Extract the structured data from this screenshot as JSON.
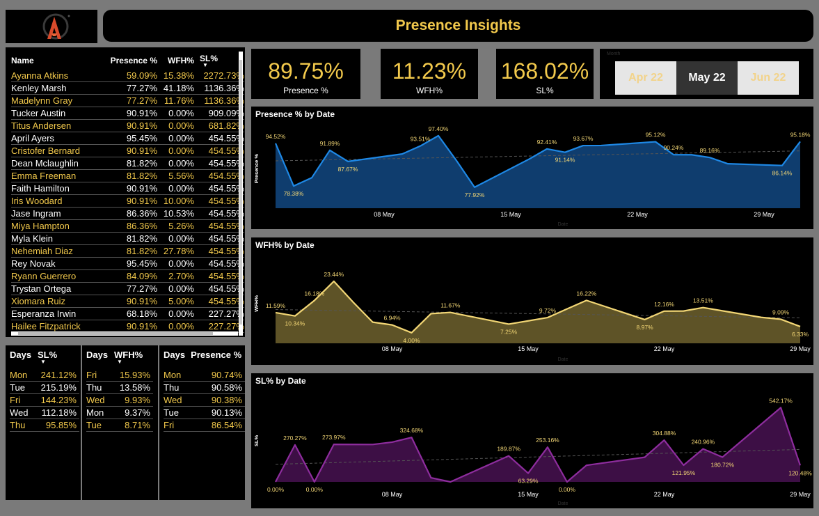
{
  "header": {
    "title": "Presence Insights"
  },
  "people": {
    "columns": [
      "Name",
      "Presence %",
      "WFH%",
      "SL%"
    ],
    "rows": [
      {
        "name": "Ayanna Atkins",
        "presence": "59.09%",
        "wfh": "15.38%",
        "sl": "2272.73%"
      },
      {
        "name": "Kenley Marsh",
        "presence": "77.27%",
        "wfh": "41.18%",
        "sl": "1136.36%"
      },
      {
        "name": "Madelynn Gray",
        "presence": "77.27%",
        "wfh": "11.76%",
        "sl": "1136.36%"
      },
      {
        "name": "Tucker Austin",
        "presence": "90.91%",
        "wfh": "0.00%",
        "sl": "909.09%"
      },
      {
        "name": "Titus Andersen",
        "presence": "90.91%",
        "wfh": "0.00%",
        "sl": "681.82%"
      },
      {
        "name": "April Ayers",
        "presence": "95.45%",
        "wfh": "0.00%",
        "sl": "454.55%"
      },
      {
        "name": "Cristofer Bernard",
        "presence": "90.91%",
        "wfh": "0.00%",
        "sl": "454.55%"
      },
      {
        "name": "Dean Mclaughlin",
        "presence": "81.82%",
        "wfh": "0.00%",
        "sl": "454.55%"
      },
      {
        "name": "Emma Freeman",
        "presence": "81.82%",
        "wfh": "5.56%",
        "sl": "454.55%"
      },
      {
        "name": "Faith Hamilton",
        "presence": "90.91%",
        "wfh": "0.00%",
        "sl": "454.55%"
      },
      {
        "name": "Iris Woodard",
        "presence": "90.91%",
        "wfh": "10.00%",
        "sl": "454.55%"
      },
      {
        "name": "Jase Ingram",
        "presence": "86.36%",
        "wfh": "10.53%",
        "sl": "454.55%"
      },
      {
        "name": "Miya Hampton",
        "presence": "86.36%",
        "wfh": "5.26%",
        "sl": "454.55%"
      },
      {
        "name": "Myla Klein",
        "presence": "81.82%",
        "wfh": "0.00%",
        "sl": "454.55%"
      },
      {
        "name": "Nehemiah Diaz",
        "presence": "81.82%",
        "wfh": "27.78%",
        "sl": "454.55%"
      },
      {
        "name": "Rey Novak",
        "presence": "95.45%",
        "wfh": "0.00%",
        "sl": "454.55%"
      },
      {
        "name": "Ryann Guerrero",
        "presence": "84.09%",
        "wfh": "2.70%",
        "sl": "454.55%"
      },
      {
        "name": "Trystan Ortega",
        "presence": "77.27%",
        "wfh": "0.00%",
        "sl": "454.55%"
      },
      {
        "name": "Xiomara Ruiz",
        "presence": "90.91%",
        "wfh": "5.00%",
        "sl": "454.55%"
      },
      {
        "name": "Esperanza Irwin",
        "presence": "68.18%",
        "wfh": "0.00%",
        "sl": "227.27%"
      },
      {
        "name": "Hailee Fitzpatrick",
        "presence": "90.91%",
        "wfh": "0.00%",
        "sl": "227.27%"
      }
    ]
  },
  "days_sl": {
    "columns": [
      "Days",
      "SL%"
    ],
    "rows": [
      {
        "day": "Mon",
        "val": "241.12%"
      },
      {
        "day": "Tue",
        "val": "215.19%"
      },
      {
        "day": "Fri",
        "val": "144.23%"
      },
      {
        "day": "Wed",
        "val": "112.18%"
      },
      {
        "day": "Thu",
        "val": "95.85%"
      }
    ]
  },
  "days_wfh": {
    "columns": [
      "Days",
      "WFH%"
    ],
    "rows": [
      {
        "day": "Fri",
        "val": "15.93%"
      },
      {
        "day": "Thu",
        "val": "13.58%"
      },
      {
        "day": "Wed",
        "val": "9.93%"
      },
      {
        "day": "Mon",
        "val": "9.37%"
      },
      {
        "day": "Tue",
        "val": "8.71%"
      }
    ]
  },
  "days_presence": {
    "columns": [
      "Days",
      "Presence %"
    ],
    "rows": [
      {
        "day": "Mon",
        "val": "90.74%"
      },
      {
        "day": "Thu",
        "val": "90.58%"
      },
      {
        "day": "Wed",
        "val": "90.38%"
      },
      {
        "day": "Tue",
        "val": "90.13%"
      },
      {
        "day": "Fri",
        "val": "86.54%"
      }
    ]
  },
  "kpis": {
    "presence": {
      "value": "89.75%",
      "label": "Presence %"
    },
    "wfh": {
      "value": "11.23%",
      "label": "WFH%"
    },
    "sl": {
      "value": "168.02%",
      "label": "SL%"
    }
  },
  "month_slicer": {
    "label": "Month",
    "options": [
      "Apr 22",
      "May 22",
      "Jun 22"
    ],
    "selected": "May 22"
  },
  "colors": {
    "accent": "#f2c94c",
    "presence": "#1e88e5",
    "wfh": "#f2d675",
    "sl": "#8e2d9e"
  },
  "chart_data": [
    {
      "type": "area",
      "title": "Presence % by Date",
      "xlabel": "Date",
      "ylabel": "Presence %",
      "x_ticks": [
        {
          "day": 8,
          "label": "08 May"
        },
        {
          "day": 15,
          "label": "15 May"
        },
        {
          "day": 22,
          "label": "22 May"
        },
        {
          "day": 29,
          "label": "29 May"
        }
      ],
      "ylim": [
        70,
        100
      ],
      "trendline": true,
      "points": [
        {
          "day": 2,
          "value": 94.52,
          "label": "94.52%"
        },
        {
          "day": 3,
          "value": 78.38,
          "label": "78.38%"
        },
        {
          "day": 4,
          "value": 81.5
        },
        {
          "day": 5,
          "value": 91.89,
          "label": "91.89%"
        },
        {
          "day": 6,
          "value": 87.67,
          "label": "87.67%"
        },
        {
          "day": 9,
          "value": 90.5
        },
        {
          "day": 10,
          "value": 93.51,
          "label": "93.51%"
        },
        {
          "day": 11,
          "value": 97.4,
          "label": "97.40%"
        },
        {
          "day": 12,
          "value": 88.0
        },
        {
          "day": 13,
          "value": 77.92,
          "label": "77.92%"
        },
        {
          "day": 16,
          "value": 88.5
        },
        {
          "day": 17,
          "value": 92.41,
          "label": "92.41%"
        },
        {
          "day": 18,
          "value": 91.14,
          "label": "91.14%"
        },
        {
          "day": 19,
          "value": 93.67,
          "label": "93.67%"
        },
        {
          "day": 20,
          "value": 93.7
        },
        {
          "day": 23,
          "value": 95.12,
          "label": "95.12%"
        },
        {
          "day": 24,
          "value": 90.24,
          "label": "90.24%"
        },
        {
          "day": 25,
          "value": 90.2
        },
        {
          "day": 26,
          "value": 89.16,
          "label": "89.16%"
        },
        {
          "day": 27,
          "value": 86.8
        },
        {
          "day": 30,
          "value": 86.14,
          "label": "86.14%"
        },
        {
          "day": 31,
          "value": 95.18,
          "label": "95.18%"
        }
      ]
    },
    {
      "type": "area",
      "title": "WFH% by Date",
      "xlabel": "Date",
      "ylabel": "WFH%",
      "x_ticks": [
        {
          "day": 8,
          "label": "08 May"
        },
        {
          "day": 15,
          "label": "15 May"
        },
        {
          "day": 22,
          "label": "22 May"
        },
        {
          "day": 29,
          "label": "29 May"
        }
      ],
      "ylim": [
        0,
        30
      ],
      "trendline": true,
      "points": [
        {
          "day": 2,
          "value": 11.59,
          "label": "11.59%"
        },
        {
          "day": 3,
          "value": 10.34,
          "label": "10.34%"
        },
        {
          "day": 4,
          "value": 16.18,
          "label": "16.18%"
        },
        {
          "day": 5,
          "value": 23.44,
          "label": "23.44%"
        },
        {
          "day": 6,
          "value": 15.5
        },
        {
          "day": 7,
          "value": 8.0
        },
        {
          "day": 8,
          "value": 6.94,
          "label": "6.94%"
        },
        {
          "day": 9,
          "value": 4.0,
          "label": "4.00%"
        },
        {
          "day": 10,
          "value": 11.2
        },
        {
          "day": 11,
          "value": 11.67,
          "label": "11.67%"
        },
        {
          "day": 14,
          "value": 7.25,
          "label": "7.25%"
        },
        {
          "day": 16,
          "value": 9.72,
          "label": "9.72%"
        },
        {
          "day": 17,
          "value": 13.0
        },
        {
          "day": 18,
          "value": 16.22,
          "label": "16.22%"
        },
        {
          "day": 21,
          "value": 8.97,
          "label": "8.97%"
        },
        {
          "day": 22,
          "value": 12.16,
          "label": "12.16%"
        },
        {
          "day": 23,
          "value": 12.2
        },
        {
          "day": 24,
          "value": 13.51,
          "label": "13.51%"
        },
        {
          "day": 27,
          "value": 9.8
        },
        {
          "day": 28,
          "value": 9.09,
          "label": "9.09%"
        },
        {
          "day": 29,
          "value": 6.33,
          "label": "6.33%"
        }
      ]
    },
    {
      "type": "area",
      "title": "SL% by Date",
      "xlabel": "Date",
      "ylabel": "SL%",
      "x_ticks": [
        {
          "day": 8,
          "label": "08 May"
        },
        {
          "day": 15,
          "label": "15 May"
        },
        {
          "day": 22,
          "label": "22 May"
        },
        {
          "day": 29,
          "label": "29 May"
        }
      ],
      "ylim": [
        0,
        600
      ],
      "trendline": true,
      "points": [
        {
          "day": 2,
          "value": 0.0,
          "label": "0.00%"
        },
        {
          "day": 3,
          "value": 270.27,
          "label": "270.27%"
        },
        {
          "day": 4,
          "value": 0.0,
          "label": "0.00%"
        },
        {
          "day": 5,
          "value": 273.97,
          "label": "273.97%"
        },
        {
          "day": 7,
          "value": 273.0
        },
        {
          "day": 8,
          "value": 290.0
        },
        {
          "day": 9,
          "value": 324.68,
          "label": "324.68%"
        },
        {
          "day": 10,
          "value": 30.0
        },
        {
          "day": 11,
          "value": 0.0
        },
        {
          "day": 14,
          "value": 189.87,
          "label": "189.87%"
        },
        {
          "day": 15,
          "value": 63.29,
          "label": "63.29%"
        },
        {
          "day": 16,
          "value": 253.16,
          "label": "253.16%"
        },
        {
          "day": 17,
          "value": 0.0,
          "label": "0.00%"
        },
        {
          "day": 18,
          "value": 121.0
        },
        {
          "day": 21,
          "value": 180.0
        },
        {
          "day": 22,
          "value": 304.88,
          "label": "304.88%"
        },
        {
          "day": 23,
          "value": 121.95,
          "label": "121.95%"
        },
        {
          "day": 24,
          "value": 240.96,
          "label": "240.96%"
        },
        {
          "day": 25,
          "value": 180.72,
          "label": "180.72%"
        },
        {
          "day": 28,
          "value": 542.17,
          "label": "542.17%"
        },
        {
          "day": 29,
          "value": 120.48,
          "label": "120.48%"
        }
      ]
    }
  ]
}
